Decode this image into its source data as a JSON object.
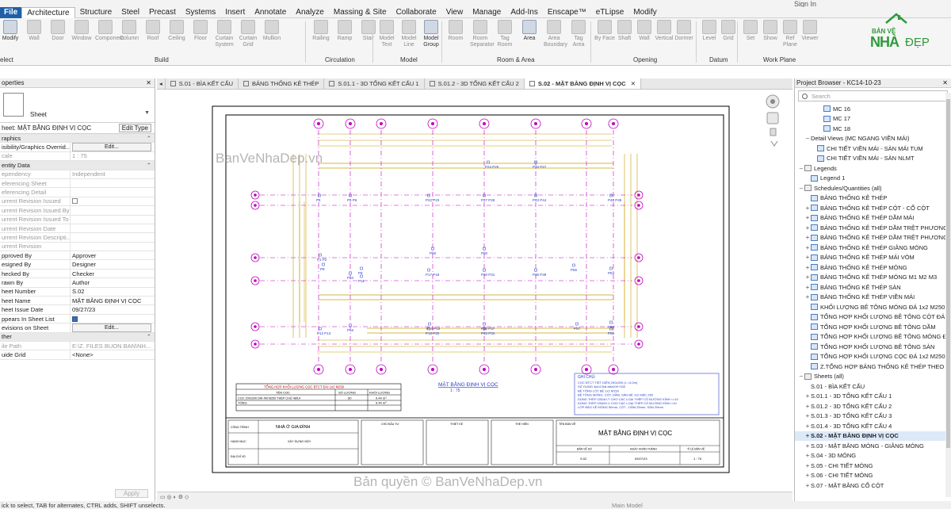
{
  "signin": "Sign In",
  "ribbon_tabs": [
    "Architecture",
    "Structure",
    "Steel",
    "Precast",
    "Systems",
    "Insert",
    "Annotate",
    "Analyze",
    "Massing & Site",
    "Collaborate",
    "View",
    "Manage",
    "Add-Ins",
    "Enscape™",
    "eTLipse",
    "Modify"
  ],
  "file_tab": "File",
  "ribbon": {
    "modify": "Modify",
    "select": "elect",
    "build_tools": [
      "Wall",
      "Door",
      "Window",
      "Component",
      "Column",
      "Roof",
      "Ceiling",
      "Floor",
      "Curtain System",
      "Curtain Grid",
      "Mullion"
    ],
    "circulation_tools": [
      "Railing",
      "Ramp",
      "Stair"
    ],
    "model_tools": [
      "Model Text",
      "Model Line",
      "Model Group"
    ],
    "room_tools": [
      "Room",
      "Room Separator",
      "Tag Room",
      "Area",
      "Area Boundary",
      "Tag Area"
    ],
    "opening_tools": [
      "By Face",
      "Shaft",
      "Wall",
      "Vertical",
      "Dormer"
    ],
    "datum_tools": [
      "Level",
      "Grid"
    ],
    "workplane_tools": [
      "Set",
      "Show",
      "Ref Plane",
      "Viewer"
    ],
    "groups": [
      "Build",
      "Circulation",
      "Model",
      "Room & Area",
      "Opening",
      "Datum",
      "Work Plane"
    ]
  },
  "logo": {
    "line1": "BẢN VẼ",
    "line2": "NHÀ",
    "line3": "ĐẸP"
  },
  "properties": {
    "title": "operties",
    "type_name": "Sheet",
    "instance": "heet: MẶT BẰNG ĐỊNH VỊ CỌC",
    "edit_type": "Edit Type",
    "rows": [
      {
        "k": "raphics",
        "v": "",
        "cat": true
      },
      {
        "k": "isibility/Graphics Overrid...",
        "v": "Edit...",
        "btn": true
      },
      {
        "k": "cale",
        "v": "1 : 75",
        "grey": true
      },
      {
        "k": "entity Data",
        "v": "",
        "cat": true
      },
      {
        "k": "ependency",
        "v": "Independent",
        "grey": true
      },
      {
        "k": "eferencing Sheet",
        "v": "",
        "grey": true
      },
      {
        "k": "eferencing Detail",
        "v": "",
        "grey": true
      },
      {
        "k": "urrent Revision Issued",
        "v": "",
        "grey": true,
        "check": "off"
      },
      {
        "k": "urrent Revision Issued By",
        "v": "",
        "grey": true
      },
      {
        "k": "urrent Revision Issued To",
        "v": "",
        "grey": true
      },
      {
        "k": "urrent Revision Date",
        "v": "",
        "grey": true
      },
      {
        "k": "urrent Revision Descripti...",
        "v": "",
        "grey": true
      },
      {
        "k": "urrent Revision",
        "v": "",
        "grey": true
      },
      {
        "k": "pproved By",
        "v": "Approver"
      },
      {
        "k": "esigned By",
        "v": "Designer"
      },
      {
        "k": "hecked By",
        "v": "Checker"
      },
      {
        "k": "rawn By",
        "v": "Author"
      },
      {
        "k": "heet Number",
        "v": "S.02"
      },
      {
        "k": "heet Name",
        "v": "MẶT BẰNG ĐỊNH VỊ CỌC"
      },
      {
        "k": "heet Issue Date",
        "v": "09/27/23"
      },
      {
        "k": "ppears In Sheet List",
        "v": "",
        "check": "on"
      },
      {
        "k": "evisions on Sheet",
        "v": "Edit...",
        "btn": true
      },
      {
        "k": "ther",
        "v": "",
        "cat": true
      },
      {
        "k": "ile Path",
        "v": "E:\\Z. FILES BUON BAN\\NH...",
        "grey": true
      },
      {
        "k": "uide Grid",
        "v": "<None>"
      }
    ],
    "apply": "Apply"
  },
  "view_tabs": [
    {
      "label": "S.01 - BÌA KẾT CẤU",
      "active": false
    },
    {
      "label": "BẢNG THỐNG KÊ THÉP",
      "active": false
    },
    {
      "label": "S.01.1 - 3D TỔNG KẾT CẤU 1",
      "active": false
    },
    {
      "label": "S.01.2 - 3D TỔNG KẾT CẤU 2",
      "active": false
    },
    {
      "label": "S.02 - MẶT BẰNG ĐỊNH VỊ CỌC",
      "active": true
    }
  ],
  "drawing": {
    "watermark": "BanVeNhaDep.vn",
    "watermark_bottom": "Bản quyền © BanVeNhaDep.vn",
    "plan_title": "MẶT BẰNG ĐỊNH VỊ CỌC",
    "plan_scale": "1 : 75",
    "pile_labels": [
      "P24 P25",
      "P46 P47",
      "P4",
      "P5 P6",
      "P22 P23",
      "P27 P28",
      "P43 P44",
      "P48 P49",
      "P59",
      "P60",
      "P1 P2",
      "P8",
      "P9",
      "P17 P18",
      "P30 P31",
      "P38 P39",
      "P56",
      "P53",
      "P10",
      "P11",
      "P14 P15",
      "P36 P37",
      "P57",
      "P54",
      "P12 P13",
      "P16",
      "P19 P20",
      "P33 P34",
      "P55"
    ],
    "dim_top": "22000",
    "table_title": "TỔNG HỢP KHỐI LƯỢNG CỌC BTCT ĐÀI 1x2 M250",
    "table_headers": [
      "TÊN CỌC",
      "SỐ LƯỢNG",
      "KHỐI LƯỢNG"
    ],
    "table_row": [
      "CỌC 200x200 DÀI 4M M250 THÉP CHỦ 4Ø14",
      "60",
      "9.44 m³"
    ],
    "table_total": [
      "TỔNG",
      "",
      "9.44 m³"
    ],
    "notes_title": "GHI CHÚ:",
    "notes": [
      "CỌC BTCT TIẾT DIỆN 200x200 (L =4.0m)",
      "SỬ DỤNG 4ø14 Đai ø6a100+150",
      "BÊ TÔNG LÓT BÊ 1x2 M150",
      "BÊ TÔNG MÓNG, CỘT, DẦM, SÀN BÊ 1x2 MÁC 250",
      "DÙNG THÉP CB240-T CHO CÁC LOẠI THÉP CÓ ĐƯỜNG KÍNH <=10",
      "DÙNG THÉP CB400-V CHO CÁC LOẠI THÉP CÓ ĐƯỜNG KÍNH >10",
      "LỚP BẢO VỆ MÓNG 50mm, CỘT - DẦM 25mm, SÀN 20mm"
    ],
    "tb_cong_trinh": "CÔNG TRÌNH",
    "tb_project": "NHÀ Ở GIA ĐÌNH",
    "tb_hang_muc": "HẠNG MỤC",
    "tb_category": "XÂY DỰNG MỚI",
    "tb_dia_chi": "ĐỊA CHỈ XD",
    "tb_owner": "CHỦ ĐẦU TƯ",
    "tb_design": "THIẾT KẾ",
    "tb_exec": "THỂ HIỆN",
    "tb_name_label": "TÊN BẢN VẼ",
    "tb_name": "MẶT BẰNG ĐỊNH VỊ CỌC",
    "tb_cols": [
      "BẢN VẼ SỐ",
      "NGÀY HOÀN THÀNH",
      "TỈ LỆ BẢN VẼ"
    ],
    "tb_vals": [
      "S.02",
      "09/27/23",
      "1 : 75"
    ]
  },
  "viewbar_scale": "",
  "status": "ick to select, TAB for alternates, CTRL adds, SHIFT unselects.",
  "status_model": "Main Model",
  "browser": {
    "title": "Project Browser - KC14-10-23",
    "search": "Search",
    "items": [
      {
        "label": "MC 16",
        "indent": 3,
        "icon": "view"
      },
      {
        "label": "MC 17",
        "indent": 3,
        "icon": "view"
      },
      {
        "label": "MC 18",
        "indent": 3,
        "icon": "view"
      },
      {
        "label": "Detail Views (MC NGANG VIỀN MÁI)",
        "indent": 1,
        "ex": "–",
        "icon": "none"
      },
      {
        "label": "CHI TIẾT VIỀN MÁI - SÀN MÁI TUM",
        "indent": 2,
        "icon": "view"
      },
      {
        "label": "CHI TIẾT VIỀN MÁI - SÀN NLMT",
        "indent": 2,
        "icon": "view"
      },
      {
        "label": "Legends",
        "indent": 0,
        "ex": "–",
        "icon": "folder"
      },
      {
        "label": "Legend 1",
        "indent": 1,
        "icon": "view"
      },
      {
        "label": "Schedules/Quantities (all)",
        "indent": 0,
        "ex": "–",
        "icon": "folder"
      },
      {
        "label": "BẢNG THỐNG KÊ THÉP",
        "indent": 1,
        "icon": "view"
      },
      {
        "label": "BẢNG THỐNG KÊ THÉP CỘT - CỔ CỘT",
        "indent": 1,
        "ex": "+",
        "icon": "view"
      },
      {
        "label": "BẢNG THỐNG KÊ THÉP DẦM MÁI",
        "indent": 1,
        "ex": "+",
        "icon": "view"
      },
      {
        "label": "BẢNG THỐNG KÊ THÉP DẦM TRỆT PHƯƠNG",
        "indent": 1,
        "ex": "+",
        "icon": "view"
      },
      {
        "label": "BẢNG THỐNG KÊ THÉP DẦM TRỆT PHƯƠNG",
        "indent": 1,
        "ex": "+",
        "icon": "view"
      },
      {
        "label": "BẢNG THỐNG KÊ THÉP GIẰNG MÓNG",
        "indent": 1,
        "ex": "+",
        "icon": "view"
      },
      {
        "label": "BẢNG THỐNG KÊ THÉP MÁI VÒM",
        "indent": 1,
        "ex": "+",
        "icon": "view"
      },
      {
        "label": "BẢNG THỐNG KÊ THÉP MÓNG",
        "indent": 1,
        "ex": "+",
        "icon": "view"
      },
      {
        "label": "BẢNG THỐNG KÊ THÉP MÓNG M1 M2 M3",
        "indent": 1,
        "ex": "+",
        "icon": "view"
      },
      {
        "label": "BẢNG THỐNG KÊ THÉP SÀN",
        "indent": 1,
        "ex": "+",
        "icon": "view"
      },
      {
        "label": "BẢNG THỐNG KÊ THÉP VIỀN MÁI",
        "indent": 1,
        "ex": "+",
        "icon": "view"
      },
      {
        "label": "KHỐI LƯỢNG BÊ TÔNG MÓNG ĐÁ 1x2 M250",
        "indent": 1,
        "icon": "view"
      },
      {
        "label": "TỔNG HỢP KHỐI LƯỢNG BÊ TÔNG CỘT ĐÁ 1",
        "indent": 1,
        "icon": "view"
      },
      {
        "label": "TỔNG HỢP KHỐI LƯỢNG BÊ TÔNG DẦM",
        "indent": 1,
        "icon": "view"
      },
      {
        "label": "TỔNG HỢP KHỐI LƯỢNG BÊ TÔNG MÓNG Đ",
        "indent": 1,
        "icon": "view"
      },
      {
        "label": "TỔNG HỢP KHỐI LƯỢNG BÊ TÔNG SÀN",
        "indent": 1,
        "icon": "view"
      },
      {
        "label": "TỔNG HỢP KHỐI LƯỢNG CỌC ĐÁ 1x2 M250",
        "indent": 1,
        "icon": "view"
      },
      {
        "label": "Z.TỔNG HỢP BẢNG THỐNG KÊ THÉP THEO Đ",
        "indent": 1,
        "icon": "view"
      },
      {
        "label": "Sheets (all)",
        "indent": 0,
        "ex": "–",
        "icon": "folder"
      },
      {
        "label": "S.01 - BÌA KẾT CẤU",
        "indent": 1,
        "icon": "none"
      },
      {
        "label": "S.01.1 - 3D TỔNG KẾT CẤU 1",
        "indent": 1,
        "ex": "+",
        "icon": "none"
      },
      {
        "label": "S.01.2 - 3D TỔNG KẾT CẤU 2",
        "indent": 1,
        "ex": "+",
        "icon": "none"
      },
      {
        "label": "S.01.3 - 3D TỔNG KẾT CẤU 3",
        "indent": 1,
        "ex": "+",
        "icon": "none"
      },
      {
        "label": "S.01.4 - 3D TỔNG KẾT CẤU 4",
        "indent": 1,
        "ex": "+",
        "icon": "none"
      },
      {
        "label": "S.02 - MẶT BẰNG ĐỊNH VỊ CỌC",
        "indent": 1,
        "ex": "+",
        "icon": "none",
        "sel": true
      },
      {
        "label": "S.03 - MẶT BẰNG MÓNG - GIẰNG MÓNG",
        "indent": 1,
        "ex": "+",
        "icon": "none"
      },
      {
        "label": "S.04 - 3D MÓNG",
        "indent": 1,
        "ex": "+",
        "icon": "none"
      },
      {
        "label": "S.05 - CHI TIẾT MÓNG",
        "indent": 1,
        "ex": "+",
        "icon": "none"
      },
      {
        "label": "S.06 - CHI TIẾT MÓNG",
        "indent": 1,
        "ex": "+",
        "icon": "none"
      },
      {
        "label": "S.07 - MẶT BẰNG CỔ CỘT",
        "indent": 1,
        "ex": "+",
        "icon": "none"
      }
    ]
  },
  "colors": {
    "grid": "#c000c0",
    "dim": "#c8a000",
    "ribbon_active": "#1f5fa8",
    "logo": "#2f9a3a"
  }
}
